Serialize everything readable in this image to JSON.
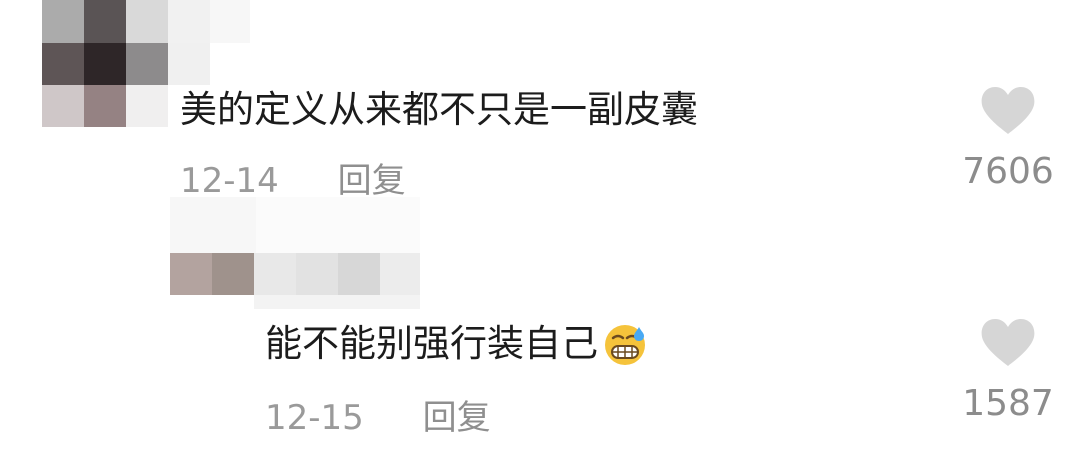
{
  "comments": [
    {
      "text": "美的定义从来都不只是一副皮囊",
      "date": "12-14",
      "reply_label": "回复",
      "like_count": "7606",
      "avatar_blurred": true
    },
    {
      "text": "能不能别强行装自己",
      "date": "12-15",
      "reply_label": "回复",
      "like_count": "1587",
      "username_blurred": true,
      "emoji": "grimacing-sweat-emoji"
    }
  ],
  "icons": {
    "like": "heart-icon"
  },
  "colors": {
    "text": "#1c1c1c",
    "meta": "#9a9a9a",
    "heart": "#d6d6d6"
  }
}
